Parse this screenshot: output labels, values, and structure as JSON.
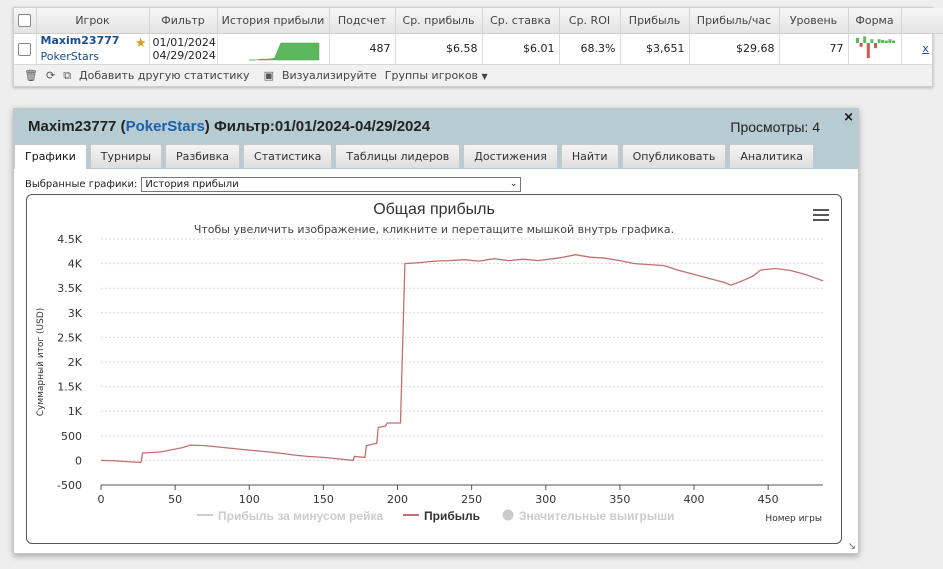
{
  "stats_table": {
    "headers": [
      "Игрок",
      "Фильтр",
      "История прибыли",
      "Подсчет",
      "Ср. прибыль",
      "Ср. ставка",
      "Ср. ROI",
      "Прибыль",
      "Прибыль/час",
      "Уровень",
      "Форма"
    ],
    "row": {
      "player": "Maxim23777",
      "site": "PokerStars",
      "filter_from": "01/01/2024",
      "filter_to": "04/29/2024",
      "count": "487",
      "avg_profit": "$6.58",
      "avg_stake": "$6.01",
      "avg_roi": "68.3%",
      "profit": "$3,651",
      "profit_per_hour": "$29.68",
      "level": "77",
      "remove": "x",
      "history_spark": [
        0,
        0,
        0.05,
        0.05,
        0.1,
        1,
        1,
        1,
        1,
        1,
        1,
        1
      ],
      "form_bars": [
        0.3,
        -0.2,
        0.4,
        -1,
        0.2,
        -0.3,
        0.2,
        0.15,
        0.1,
        0.2,
        0.1
      ]
    },
    "toolbar": {
      "add_stats": "Добавить другую статистику",
      "visualize": "Визуализируйте",
      "groups": "Группы игроков"
    }
  },
  "dialog": {
    "player": "Maxim23777",
    "site": "PokerStars",
    "filter_label": "Фильтр:01/01/2024-04/29/2024",
    "views": "Просмотры: 4",
    "close": "×",
    "tabs": [
      "Графики",
      "Турниры",
      "Разбивка",
      "Статистика",
      "Таблицы лидеров",
      "Достижения",
      "Найти",
      "Опубликовать",
      "Аналитика"
    ],
    "selected_tab": "Графики",
    "select_label": "Выбранные графики:",
    "select_value": "История прибыли"
  },
  "chart_data": {
    "type": "line",
    "title": "Общая прибыль",
    "subtitle": "Чтобы увеличить изображение, кликните и перетащите мышкой внутрь графика.",
    "ylabel": "Суммарный итог (USD)",
    "xlabel": "Номер игры",
    "xlim": [
      0,
      487
    ],
    "ylim": [
      -500,
      4500
    ],
    "x_ticks": [
      0,
      50,
      100,
      150,
      200,
      250,
      300,
      350,
      400,
      450
    ],
    "y_ticks": [
      -500,
      0,
      500,
      1000,
      1500,
      2000,
      2500,
      3000,
      3500,
      4000,
      4500
    ],
    "y_tick_labels": [
      "-500",
      "0",
      "500",
      "1K",
      "1.5K",
      "2K",
      "2.5K",
      "3K",
      "3.5K",
      "4K",
      "4.5K"
    ],
    "legend": [
      "Прибыль за минусом рейка",
      "Прибыль",
      "Значительные выигрыши"
    ],
    "legend_active": [
      false,
      true,
      false
    ],
    "series": [
      {
        "name": "Прибыль",
        "color": "#c0706f",
        "points": [
          [
            0,
            0
          ],
          [
            10,
            -10
          ],
          [
            20,
            -30
          ],
          [
            27,
            -40
          ],
          [
            28,
            150
          ],
          [
            40,
            170
          ],
          [
            55,
            260
          ],
          [
            60,
            310
          ],
          [
            70,
            300
          ],
          [
            80,
            270
          ],
          [
            90,
            240
          ],
          [
            100,
            210
          ],
          [
            110,
            180
          ],
          [
            120,
            150
          ],
          [
            130,
            110
          ],
          [
            140,
            80
          ],
          [
            150,
            60
          ],
          [
            160,
            30
          ],
          [
            170,
            0
          ],
          [
            171,
            80
          ],
          [
            178,
            60
          ],
          [
            179,
            300
          ],
          [
            186,
            350
          ],
          [
            187,
            670
          ],
          [
            192,
            700
          ],
          [
            193,
            760
          ],
          [
            202,
            760
          ],
          [
            205,
            4000
          ],
          [
            215,
            4020
          ],
          [
            225,
            4050
          ],
          [
            235,
            4060
          ],
          [
            245,
            4080
          ],
          [
            255,
            4050
          ],
          [
            265,
            4100
          ],
          [
            275,
            4060
          ],
          [
            285,
            4090
          ],
          [
            295,
            4060
          ],
          [
            305,
            4100
          ],
          [
            310,
            4120
          ],
          [
            320,
            4180
          ],
          [
            330,
            4130
          ],
          [
            340,
            4110
          ],
          [
            350,
            4060
          ],
          [
            360,
            4000
          ],
          [
            370,
            3980
          ],
          [
            380,
            3960
          ],
          [
            390,
            3860
          ],
          [
            400,
            3780
          ],
          [
            410,
            3700
          ],
          [
            420,
            3620
          ],
          [
            425,
            3560
          ],
          [
            435,
            3680
          ],
          [
            440,
            3750
          ],
          [
            445,
            3870
          ],
          [
            455,
            3900
          ],
          [
            465,
            3860
          ],
          [
            475,
            3780
          ],
          [
            487,
            3651
          ]
        ]
      }
    ]
  }
}
